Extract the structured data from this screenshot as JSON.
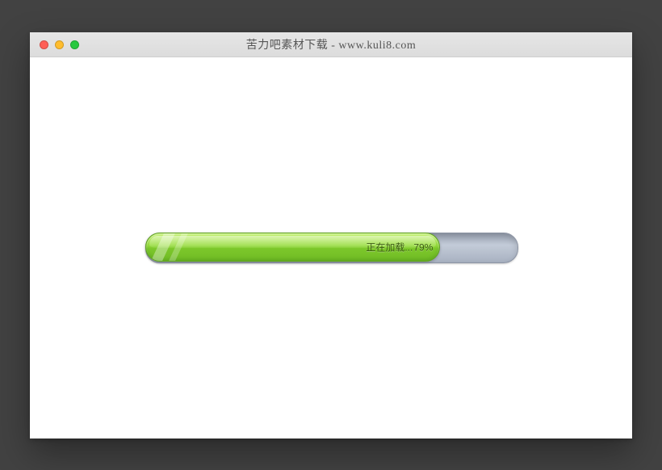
{
  "window": {
    "title": "苦力吧素材下载 - www.kuli8.com"
  },
  "progress": {
    "percent": 79,
    "loading_text": "正在加载...",
    "percent_suffix": "%"
  }
}
